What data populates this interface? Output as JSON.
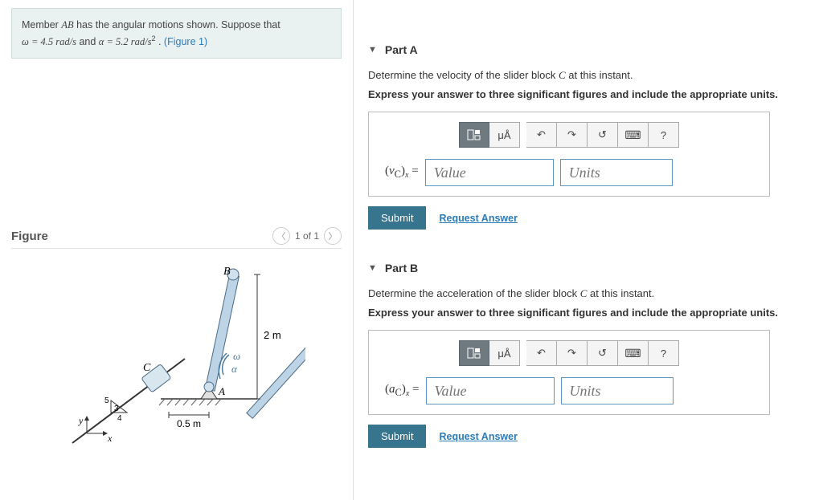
{
  "problem": {
    "text_prefix": "Member ",
    "member": "AB",
    "text_mid1": " has the angular motions shown. Suppose that",
    "omega_eq": "ω = 4.5 rad/s",
    "and": " and ",
    "alpha_eq": "α = 5.2 rad/s",
    "alpha_exp": "2",
    "period": " . ",
    "figure_link": "(Figure 1)"
  },
  "figure": {
    "heading": "Figure",
    "pager_text": "1 of 1",
    "labels": {
      "B": "B",
      "C": "C",
      "A": "A",
      "omega": "ω",
      "alpha": "α",
      "dim2m": "2 m",
      "dim05m": "0.5 m",
      "ang5": "5",
      "ang3": "3",
      "ang4": "4",
      "y": "y",
      "x": "x"
    }
  },
  "parts": [
    {
      "title": "Part A",
      "prompt_pre": "Determine the velocity of the slider block ",
      "prompt_var": "C",
      "prompt_post": " at this instant.",
      "bold": "Express your answer to three significant figures and include the appropriate units.",
      "var_html": "(v_C)_x =",
      "value_ph": "Value",
      "units_ph": "Units",
      "submit": "Submit",
      "request": "Request Answer"
    },
    {
      "title": "Part B",
      "prompt_pre": "Determine the acceleration of the slider block ",
      "prompt_var": "C",
      "prompt_post": " at this instant.",
      "bold": "Express your answer to three significant figures and include the appropriate units.",
      "var_html": "(a_C)_x =",
      "value_ph": "Value",
      "units_ph": "Units",
      "submit": "Submit",
      "request": "Request Answer"
    }
  ],
  "toolbar": {
    "mu": "μÅ",
    "undo": "↶",
    "redo": "↷",
    "reset": "↺",
    "keyboard": "⌨",
    "help": "?"
  }
}
